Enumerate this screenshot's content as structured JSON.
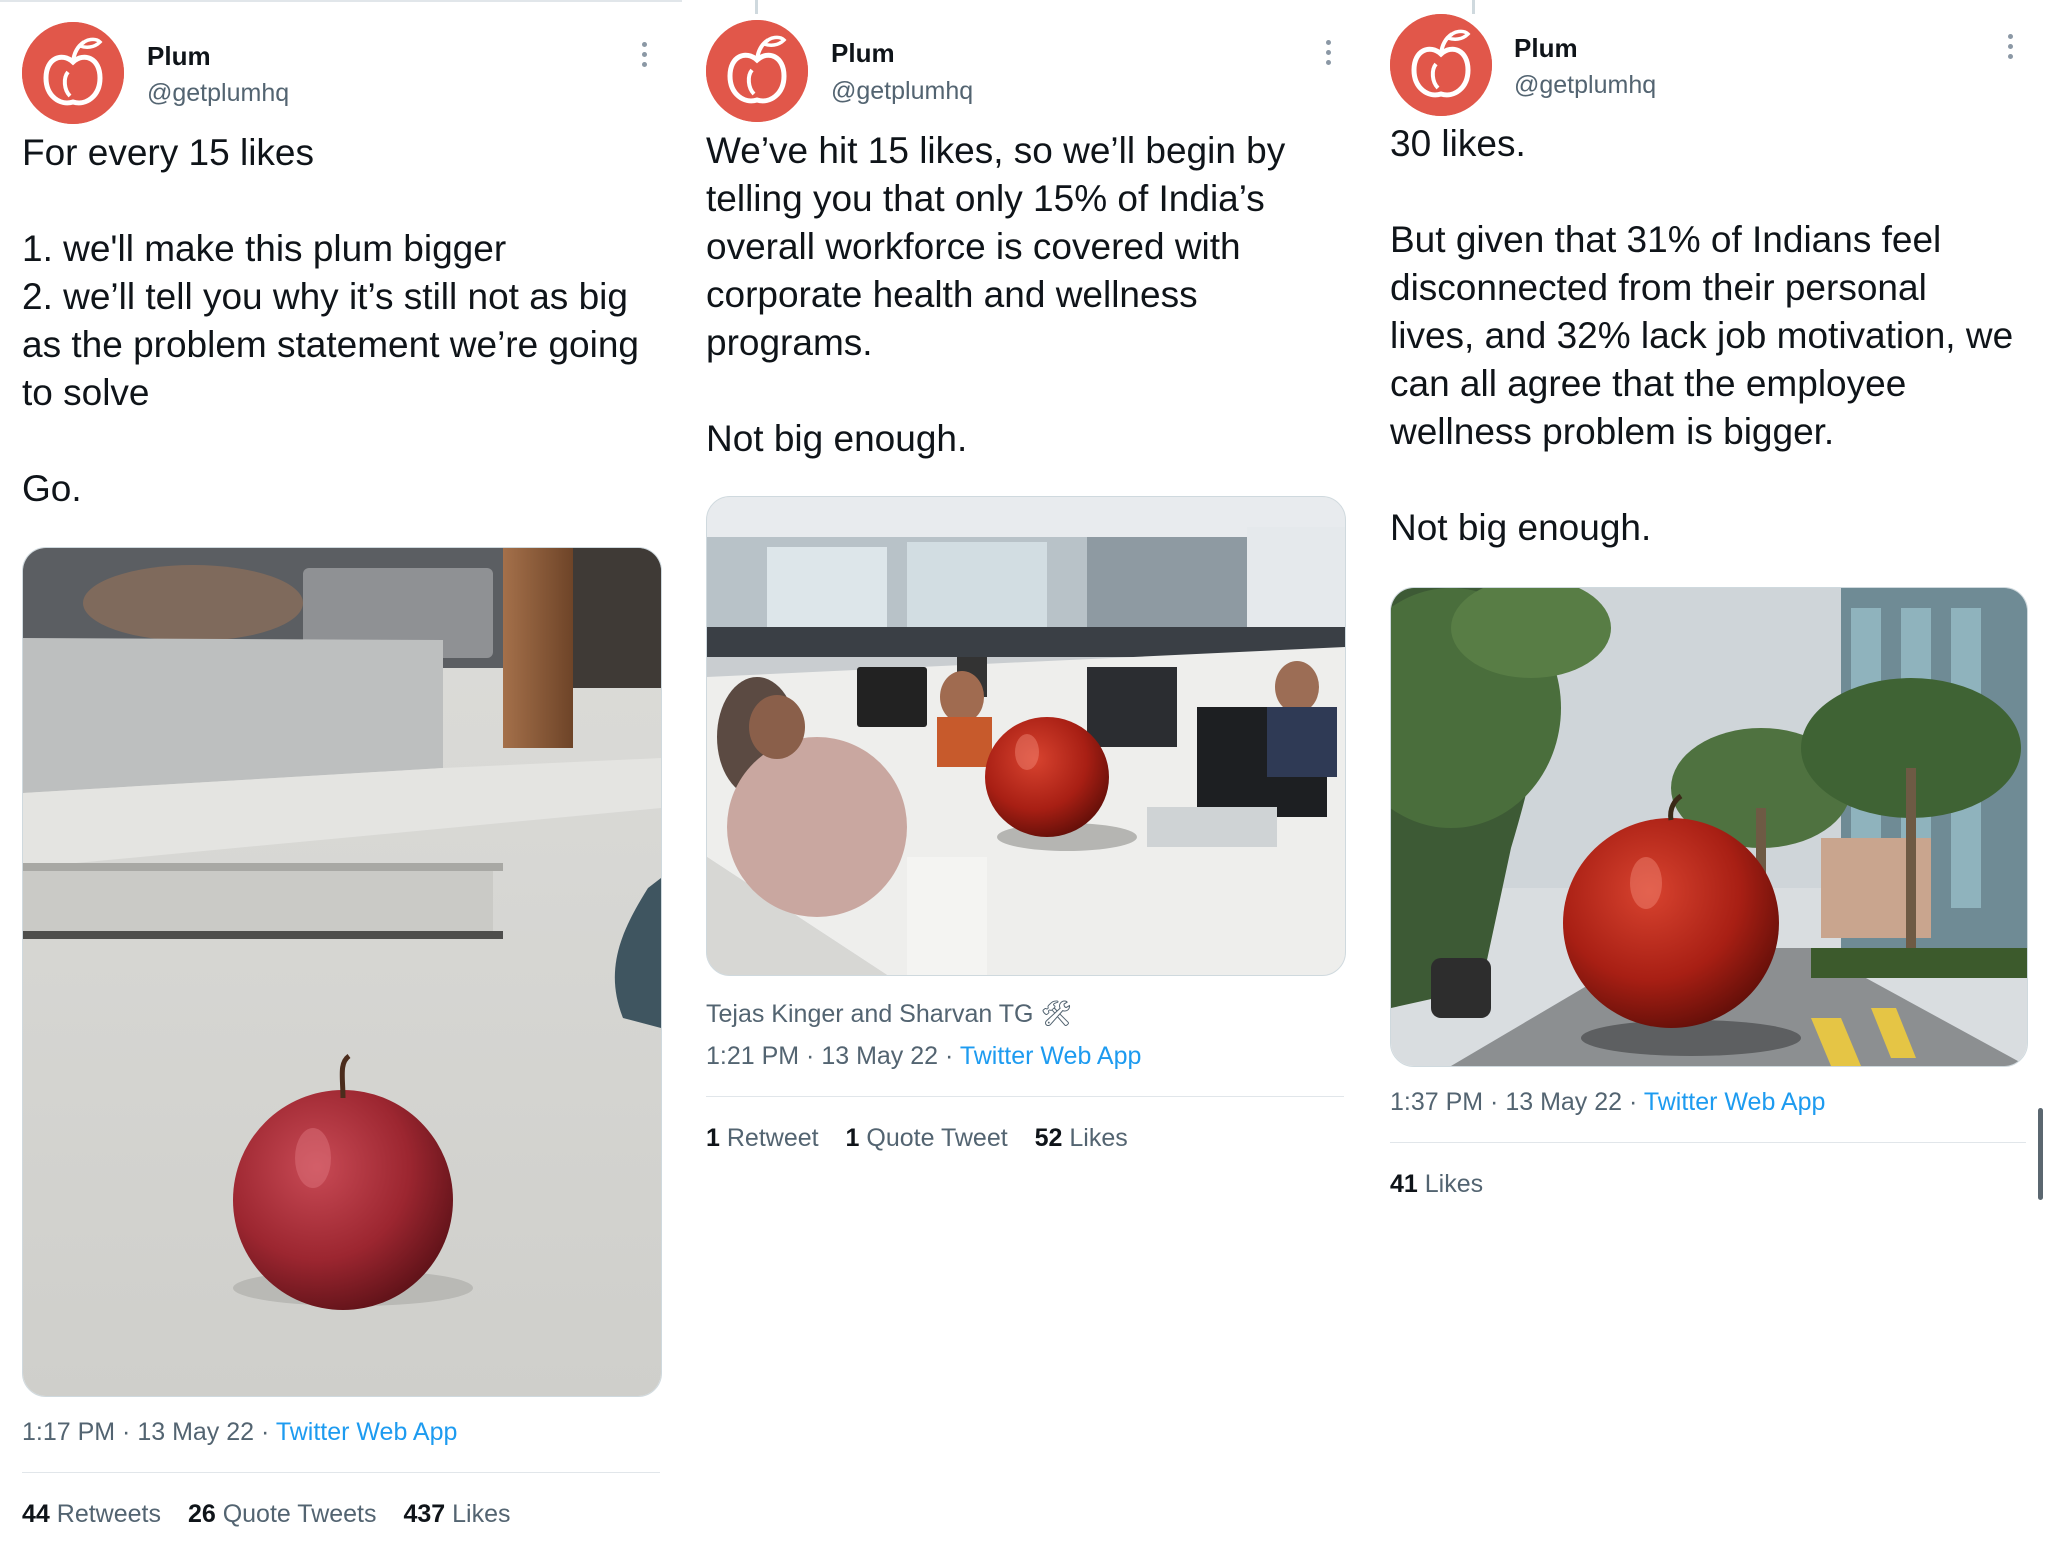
{
  "accent_color": "#1d9bf0",
  "avatar_color": "#e1574a",
  "tweets": [
    {
      "name": "Plum",
      "handle": "@getplumhq",
      "text": "For every 15 likes\n\n1. we'll make this plum bigger\n2. we’ll tell you why it’s still not as big\nas the problem statement we’re going\nto solve\n\nGo.",
      "image_icon": "apple-on-desk-photo",
      "tagged": "",
      "time": "1:17 PM",
      "date": "13 May 22",
      "source": "Twitter Web App",
      "stats": {
        "retweets_count": "44",
        "retweets_label": "Retweets",
        "quotes_count": "26",
        "quotes_label": "Quote Tweets",
        "likes_count": "437",
        "likes_label": "Likes"
      }
    },
    {
      "name": "Plum",
      "handle": "@getplumhq",
      "text": "We’ve hit 15 likes, so we’ll begin by\ntelling you that only 15% of India’s\noverall workforce is covered with\ncorporate health and wellness\nprograms.\n\nNot big enough.",
      "image_icon": "office-with-giant-plum-photo",
      "tagged": "Tejas Kinger and Sharvan TG 🛠",
      "time": "1:21 PM",
      "date": "13 May 22",
      "source": "Twitter Web App",
      "stats": {
        "retweets_count": "1",
        "retweets_label": "Retweet",
        "quotes_count": "1",
        "quotes_label": "Quote Tweet",
        "likes_count": "52",
        "likes_label": "Likes"
      }
    },
    {
      "name": "Plum",
      "handle": "@getplumhq",
      "text": "30 likes.\n\nBut given that 31% of Indians feel\ndisconnected from their personal\nlives, and 32% lack job motivation, we\ncan all agree that the employee\nwellness problem is bigger.\n\nNot big enough.",
      "image_icon": "street-with-giant-plum-photo",
      "tagged": "",
      "time": "1:37 PM",
      "date": "13 May 22",
      "source": "Twitter Web App",
      "stats": {
        "likes_count": "41",
        "likes_label": "Likes"
      }
    }
  ]
}
